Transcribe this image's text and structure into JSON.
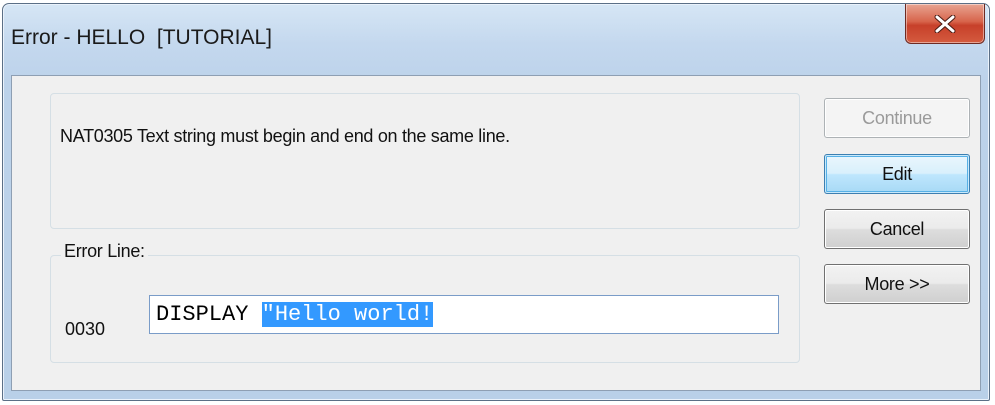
{
  "window": {
    "title": "Error - HELLO  [TUTORIAL]",
    "close_icon": "close-icon"
  },
  "message": {
    "text": "NAT0305 Text string must begin and end on the same line."
  },
  "error_line": {
    "group_label": "Error Line:",
    "line_number": "0030",
    "code_prefix": "DISPLAY ",
    "code_selected": "\"Hello world!"
  },
  "buttons": {
    "continue_label": "Continue",
    "edit_label": "Edit",
    "cancel_label": "Cancel",
    "more_label": "More >>"
  },
  "colors": {
    "selection": "#3399ff",
    "close_button": "#c7402a",
    "default_button_border": "#3c7fb1"
  }
}
